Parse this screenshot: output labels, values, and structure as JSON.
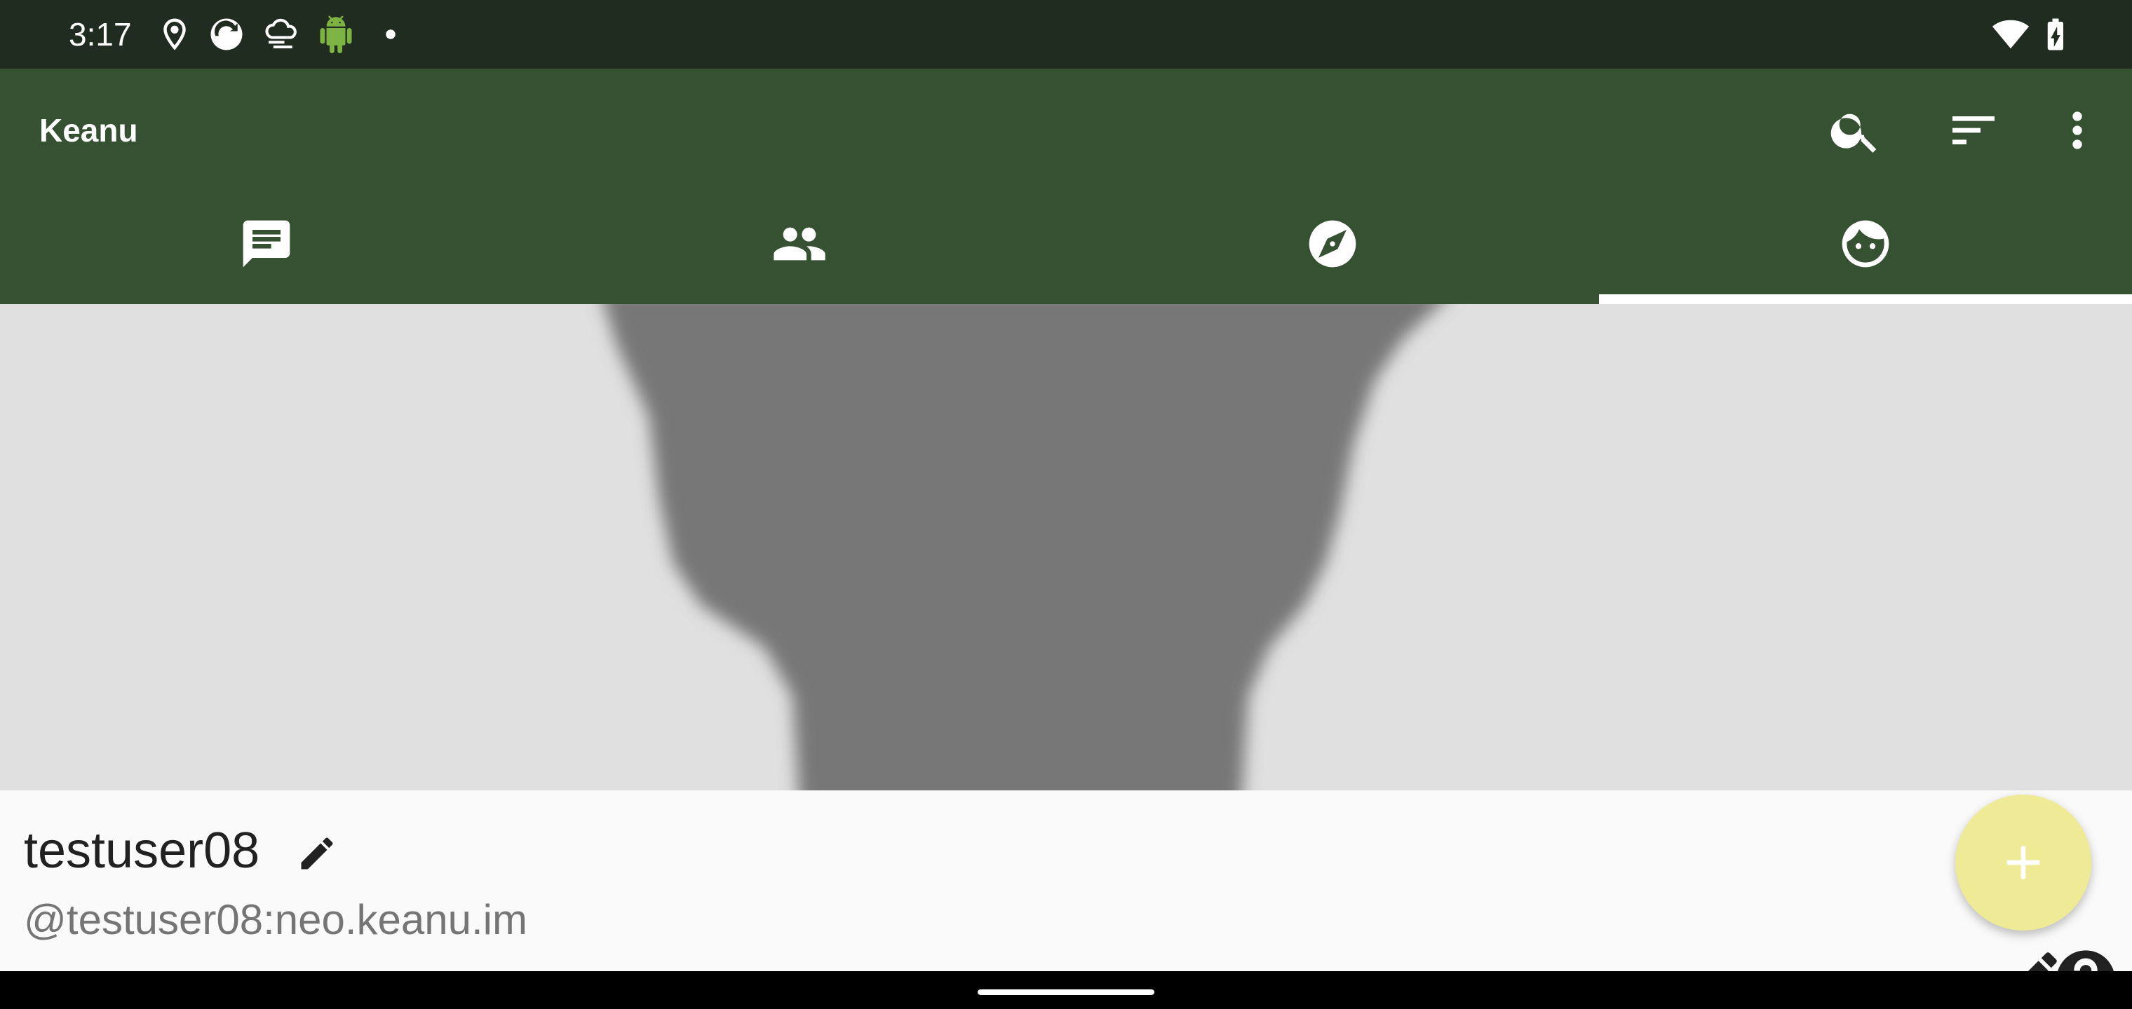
{
  "status_bar": {
    "time": "3:17",
    "left_icons": [
      "location-icon",
      "sync-app-icon",
      "weather-icon",
      "android-icon",
      "notification-dot-icon"
    ],
    "right_icons": [
      "wifi-icon",
      "battery-charging-icon"
    ]
  },
  "app_bar": {
    "title": "Keanu",
    "actions": [
      "search-icon",
      "sort-icon",
      "more-vert-icon"
    ],
    "tabs": [
      {
        "icon": "chat-icon",
        "selected": false
      },
      {
        "icon": "people-icon",
        "selected": false
      },
      {
        "icon": "explore-icon",
        "selected": false
      },
      {
        "icon": "face-icon",
        "selected": true
      }
    ]
  },
  "profile": {
    "display_name": "testuser08",
    "user_id": "@testuser08:neo.keanu.im"
  },
  "fab": {
    "icon": "add-icon"
  },
  "colors": {
    "status_bar": "#212c20",
    "app_bar": "#365132",
    "cover_bg": "#e0e0e0",
    "cover_shape": "#777777",
    "fab": "#eeea96"
  }
}
